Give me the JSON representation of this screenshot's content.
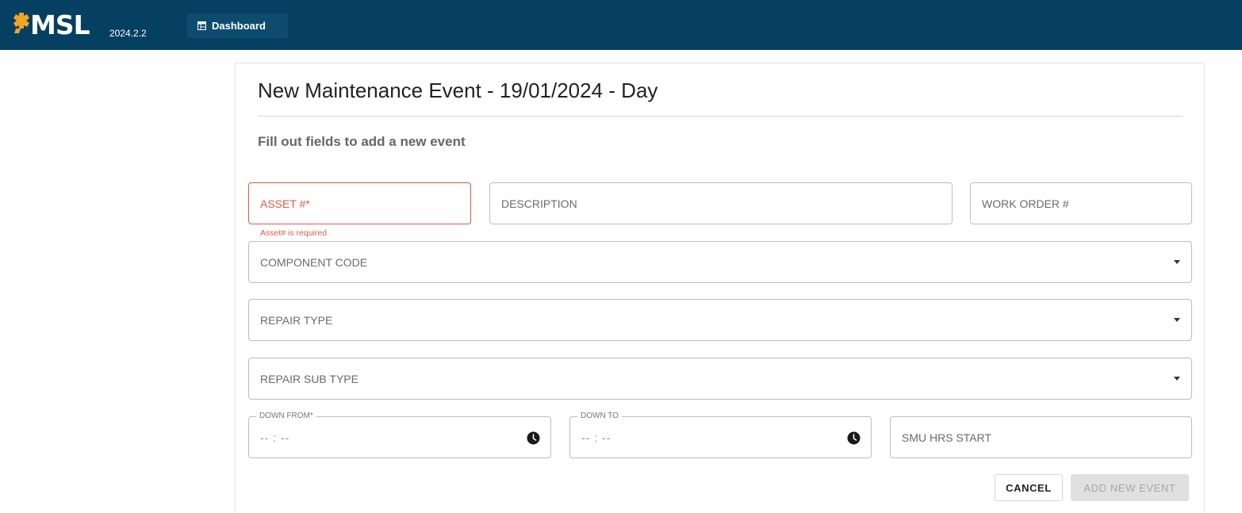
{
  "header": {
    "logo_text": "MSL",
    "version": "2024.2.2",
    "nav": {
      "dashboard_label": "Dashboard"
    }
  },
  "form": {
    "title": "New Maintenance Event - 19/01/2024 - Day",
    "subtitle": "Fill out fields to add a new event",
    "asset": {
      "placeholder": "ASSET #*",
      "error": "Asset# is required"
    },
    "description": {
      "placeholder": "DESCRIPTION"
    },
    "work_order": {
      "placeholder": "WORK ORDER #"
    },
    "component_code": {
      "placeholder": "COMPONENT CODE"
    },
    "repair_type": {
      "placeholder": "REPAIR TYPE"
    },
    "repair_sub_type": {
      "placeholder": "REPAIR SUB TYPE"
    },
    "down_from": {
      "label": "DOWN FROM*",
      "value": "-- : --"
    },
    "down_to": {
      "label": "DOWN TO",
      "value": "-- : --"
    },
    "smu_hrs_start": {
      "placeholder": "SMU HRS START"
    },
    "cancel_label": "CANCEL",
    "add_label": "ADD NEW EVENT"
  },
  "colors": {
    "topbar": "#053f62",
    "logo_accent": "#f0a526",
    "error": "#e05a4b"
  },
  "icons": [
    "gear-logo-icon",
    "dashboard-icon",
    "dropdown-arrow-icon",
    "clock-icon"
  ]
}
